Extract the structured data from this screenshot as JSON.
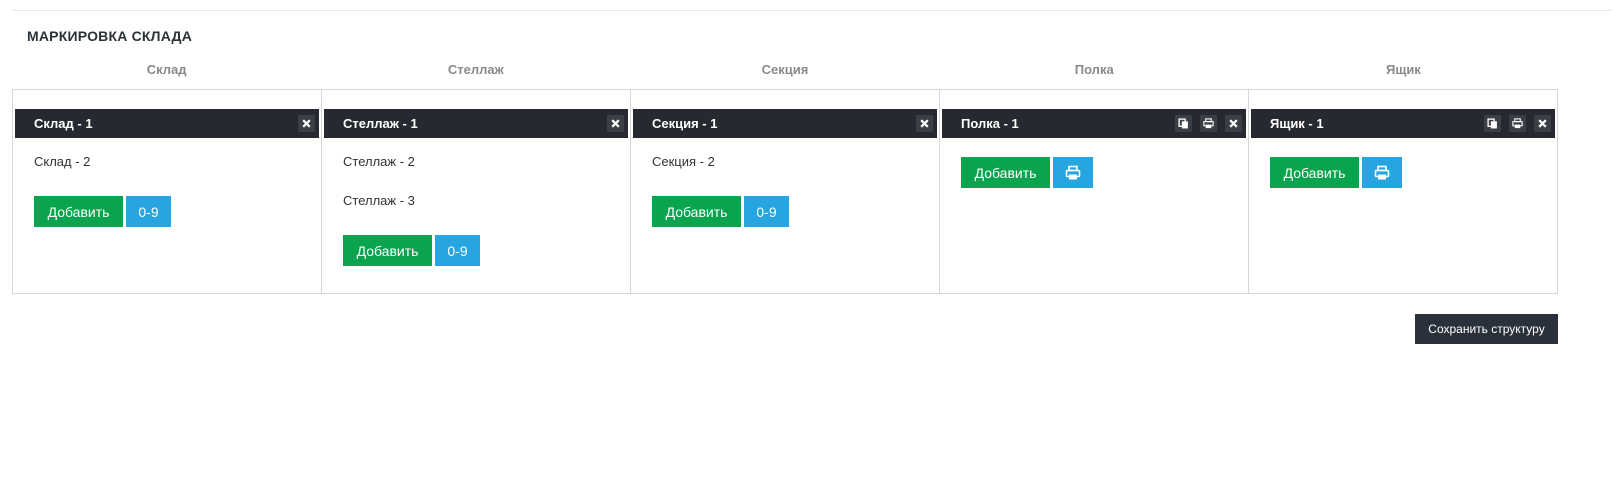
{
  "page": {
    "title": "МАРКИРОВКА СКЛАДА",
    "save_button": "Сохранить структуру"
  },
  "columns": [
    {
      "header": "Склад",
      "selected": "Склад - 1",
      "items": [
        "Склад - 2"
      ],
      "add_label": "Добавить",
      "range_label": "0-9",
      "actions": [
        "close-icon"
      ]
    },
    {
      "header": "Стеллаж",
      "selected": "Стеллаж - 1",
      "items": [
        "Стеллаж - 2",
        "Стеллаж - 3"
      ],
      "add_label": "Добавить",
      "range_label": "0-9",
      "actions": [
        "close-icon"
      ]
    },
    {
      "header": "Секция",
      "selected": "Секция - 1",
      "items": [
        "Секция - 2"
      ],
      "add_label": "Добавить",
      "range_label": "0-9",
      "actions": [
        "close-icon"
      ]
    },
    {
      "header": "Полка",
      "selected": "Полка - 1",
      "items": [],
      "add_label": "Добавить",
      "actions": [
        "copy-icon",
        "print-icon",
        "close-icon"
      ],
      "secondary_button": "print-icon"
    },
    {
      "header": "Ящик",
      "selected": "Ящик - 1",
      "items": [],
      "add_label": "Добавить",
      "actions": [
        "copy-icon",
        "print-icon",
        "close-icon"
      ],
      "secondary_button": "print-icon"
    }
  ],
  "colors": {
    "dark": "#262a30",
    "green": "#0aa34e",
    "blue": "#26a5e0"
  }
}
